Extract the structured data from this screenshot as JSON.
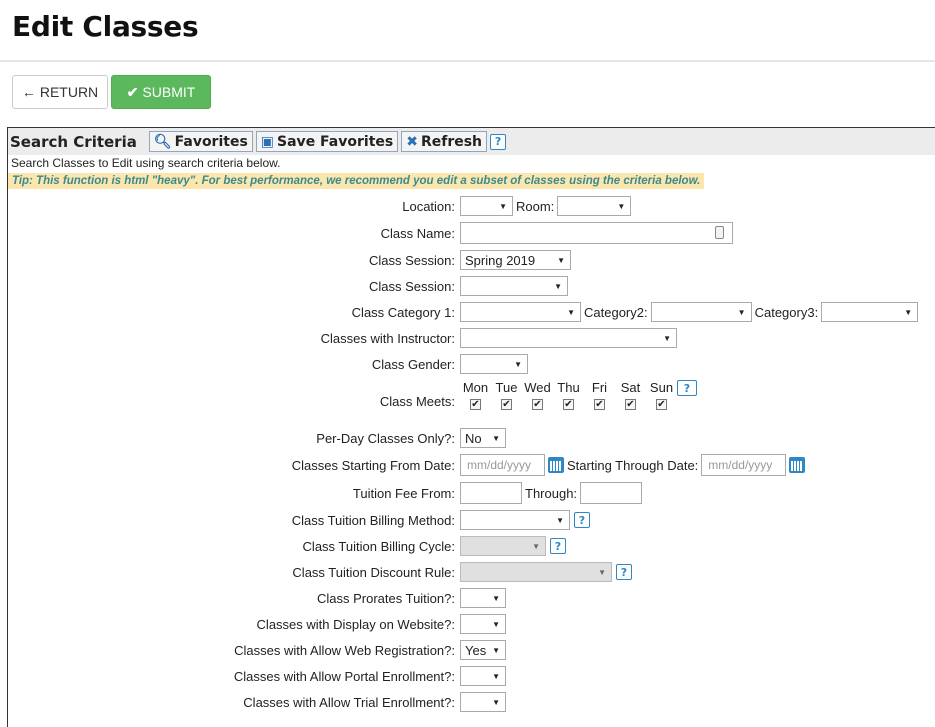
{
  "page": {
    "title": "Edit Classes"
  },
  "toolbar": {
    "return_label": "RETURN",
    "submit_label": "SUBMIT"
  },
  "panel": {
    "title": "Search Criteria",
    "favorites_label": "Favorites",
    "save_favorites_label": "Save Favorites",
    "refresh_label": "Refresh",
    "help": "?",
    "description": "Search Classes to Edit using search criteria below.",
    "tip": "Tip: This function is html \"heavy\".  For best performance, we recommend you edit a subset of classes using the criteria below."
  },
  "form": {
    "location_label": "Location:",
    "room_label": "Room:",
    "class_name_label": "Class Name:",
    "class_session_label": "Class Session:",
    "class_session_value": "Spring 2019",
    "class_session2_label": "Class Session:",
    "category1_label": "Class Category 1:",
    "category2_label": "Category2:",
    "category3_label": "Category3:",
    "instructor_label": "Classes with Instructor:",
    "gender_label": "Class Gender:",
    "meets_label": "Class Meets:",
    "days": [
      "Mon",
      "Tue",
      "Wed",
      "Thu",
      "Fri",
      "Sat",
      "Sun"
    ],
    "per_day_label": "Per-Day Classes Only?:",
    "per_day_value": "No",
    "start_from_label": "Classes Starting From Date:",
    "start_from_placeholder": "mm/dd/yyyy",
    "start_through_label": "Starting Through Date:",
    "start_through_placeholder": "mm/dd/yyyy",
    "tuition_from_label": "Tuition Fee From:",
    "through_label": "Through:",
    "billing_method_label": "Class Tuition Billing Method:",
    "billing_cycle_label": "Class Tuition Billing Cycle:",
    "discount_rule_label": "Class Tuition Discount Rule:",
    "prorates_label": "Class Prorates Tuition?:",
    "display_website_label": "Classes with Display on Website?:",
    "web_registration_label": "Classes with Allow Web Registration?:",
    "web_registration_value": "Yes",
    "portal_enrollment_label": "Classes with Allow Portal Enrollment?:",
    "trial_enrollment_label": "Classes with Allow Trial Enrollment?:"
  },
  "colors": {
    "submit": "#5cb85c",
    "tip_bg": "#fbe7ad",
    "tip_text": "#3b8a8e",
    "accent": "#2f87c8"
  }
}
